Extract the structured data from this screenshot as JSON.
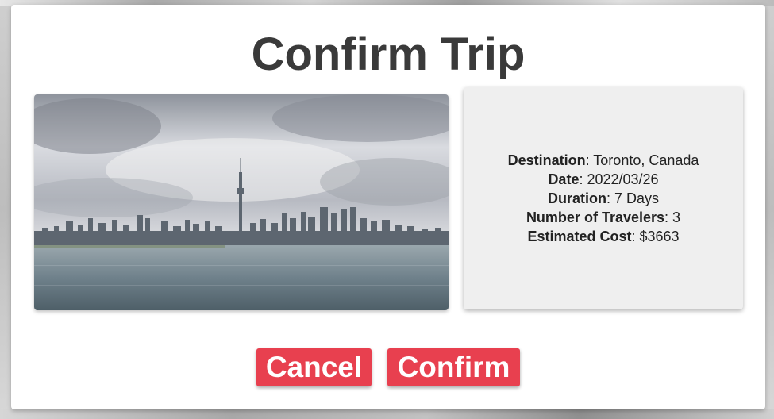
{
  "modal": {
    "title": "Confirm Trip",
    "image": {
      "icon": "toronto-skyline-photo",
      "description_colors": {
        "sky": "#c9ccd3",
        "water": "#7b8c95",
        "city": "#5d6670"
      }
    },
    "details": [
      {
        "label": "Destination",
        "value": "Toronto, Canada"
      },
      {
        "label": "Date",
        "value": "2022/03/26"
      },
      {
        "label": "Duration",
        "value": "7 Days"
      },
      {
        "label": "Number of Travelers",
        "value": "3"
      },
      {
        "label": "Estimated Cost",
        "value": "$3663"
      }
    ],
    "buttons": {
      "cancel_label": "Cancel",
      "confirm_label": "Confirm",
      "color": "#e8404f"
    }
  }
}
